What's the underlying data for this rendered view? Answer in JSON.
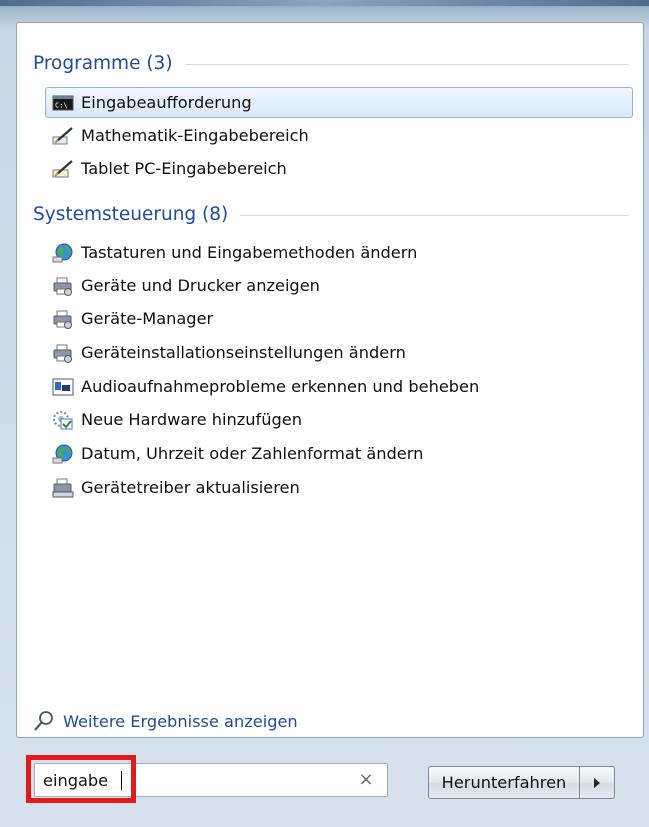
{
  "programs": {
    "header": "Programme (3)",
    "items": [
      {
        "label": "Eingabeaufforderung",
        "icon": "command-prompt-icon",
        "selected": true
      },
      {
        "label": "Mathematik-Eingabebereich",
        "icon": "math-input-pen-icon"
      },
      {
        "label": "Tablet PC-Eingabebereich",
        "icon": "tablet-pen-icon"
      }
    ]
  },
  "control_panel": {
    "header": "Systemsteuerung (8)",
    "items": [
      {
        "label": "Tastaturen und Eingabemethoden ändern",
        "icon": "globe-icon"
      },
      {
        "label": "Geräte und Drucker anzeigen",
        "icon": "printer-icon"
      },
      {
        "label": "Geräte-Manager",
        "icon": "printer-icon"
      },
      {
        "label": "Geräteinstallationseinstellungen ändern",
        "icon": "printer-icon"
      },
      {
        "label": "Audioaufnahmeprobleme erkennen und beheben",
        "icon": "troubleshoot-icon"
      },
      {
        "label": "Neue Hardware hinzufügen",
        "icon": "hardware-wizard-icon"
      },
      {
        "label": "Datum, Uhrzeit oder Zahlenformat ändern",
        "icon": "globe-icon"
      },
      {
        "label": "Gerätetreiber aktualisieren",
        "icon": "driver-update-icon"
      }
    ]
  },
  "more_results": "Weitere Ergebnisse anzeigen",
  "search": {
    "value": "eingabe",
    "clear_icon": "×"
  },
  "shutdown": {
    "label": "Herunterfahren",
    "arrow_icon": "▸"
  },
  "colors": {
    "accent": "#1e4c98",
    "selection": "#d6e8fa",
    "highlight": "#e01b1b"
  }
}
